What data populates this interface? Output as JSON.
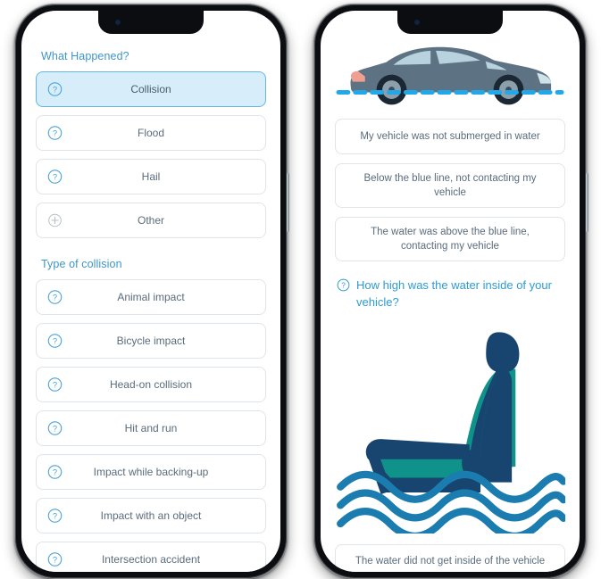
{
  "left_phone": {
    "section1": {
      "title": "What Happened?",
      "options": [
        {
          "label": "Collision",
          "icon": "question-circle-icon",
          "selected": true
        },
        {
          "label": "Flood",
          "icon": "question-circle-icon",
          "selected": false
        },
        {
          "label": "Hail",
          "icon": "question-circle-icon",
          "selected": false
        },
        {
          "label": "Other",
          "icon": "plus-circle-icon",
          "selected": false
        }
      ]
    },
    "section2": {
      "title": "Type of collision",
      "options": [
        {
          "label": "Animal impact",
          "icon": "question-circle-icon"
        },
        {
          "label": "Bicycle impact",
          "icon": "question-circle-icon"
        },
        {
          "label": "Head-on collision",
          "icon": "question-circle-icon"
        },
        {
          "label": "Hit and run",
          "icon": "question-circle-icon"
        },
        {
          "label": "Impact while backing-up",
          "icon": "question-circle-icon"
        },
        {
          "label": "Impact with an object",
          "icon": "question-circle-icon"
        },
        {
          "label": "Intersection accident",
          "icon": "question-circle-icon"
        }
      ]
    }
  },
  "right_phone": {
    "car_illustration": {
      "name": "car-side-view-with-blue-waterline-illustration",
      "body_color": "#5d7384",
      "window_color": "#b8d3de",
      "waterline_color": "#22a7e8",
      "taillight_color": "#f0a090"
    },
    "water_level_options": [
      {
        "label": "My vehicle was not submerged in water",
        "lines": 1
      },
      {
        "label": "Below the blue line, not contacting my vehicle",
        "lines": 2
      },
      {
        "label": "The water was above the blue line, contacting my vehicle",
        "lines": 2
      }
    ],
    "question": {
      "icon": "question-circle-icon",
      "text": "How high was the water inside of your vehicle?"
    },
    "seat_illustration": {
      "name": "car-seat-in-water-illustration",
      "seat_color": "#0f9289",
      "outline_color": "#17456f",
      "water_color": "#1b7cb0"
    },
    "inside_water_options": [
      {
        "label": "The water did not get inside of the vehicle",
        "lines": 1
      }
    ]
  },
  "colors": {
    "accent_blue": "#3e96cc",
    "heading_blue": "#2e9bd6",
    "selected_fill": "#d7eefa",
    "selected_border": "#63b6e2",
    "card_border": "#dfe4ea",
    "body_text": "#5a6c7d",
    "frame": "#0b0d10"
  }
}
